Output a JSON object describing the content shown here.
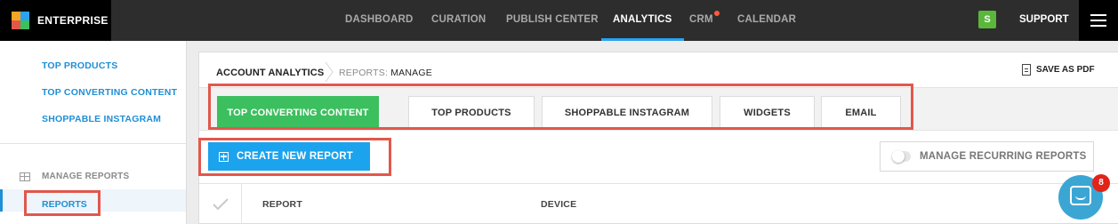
{
  "brand": {
    "name": "ENTERPRISE"
  },
  "nav": {
    "items": [
      {
        "label": "DASHBOARD"
      },
      {
        "label": "CURATION"
      },
      {
        "label": "PUBLISH CENTER"
      },
      {
        "label": "ANALYTICS",
        "active": true
      },
      {
        "label": "CRM",
        "notification_dot": true
      },
      {
        "label": "CALENDAR"
      }
    ],
    "user_initial": "S",
    "support_label": "SUPPORT"
  },
  "sidebar": {
    "links": [
      {
        "label": "TOP PRODUCTS"
      },
      {
        "label": "TOP CONVERTING CONTENT"
      },
      {
        "label": "SHOPPABLE INSTAGRAM"
      }
    ],
    "section_label": "MANAGE REPORTS",
    "active_item": "REPORTS"
  },
  "breadcrumb": {
    "root": "ACCOUNT ANALYTICS",
    "section": "REPORTS:",
    "page": "MANAGE"
  },
  "actions": {
    "save_pdf": "SAVE AS PDF",
    "create_report": "CREATE NEW REPORT",
    "manage_recurring": "MANAGE RECURRING REPORTS"
  },
  "tabs": [
    {
      "label": "TOP CONVERTING CONTENT",
      "active": true
    },
    {
      "label": "TOP PRODUCTS"
    },
    {
      "label": "SHOPPABLE INSTAGRAM"
    },
    {
      "label": "WIDGETS"
    },
    {
      "label": "EMAIL"
    }
  ],
  "table": {
    "columns": [
      "REPORT",
      "DEVICE"
    ]
  },
  "chat": {
    "unread_count": "8"
  },
  "colors": {
    "accent_blue": "#1ba3ee",
    "active_tab_green": "#3cbf5e",
    "highlight_red": "#e2574c",
    "topbar": "#2d2d2d"
  }
}
